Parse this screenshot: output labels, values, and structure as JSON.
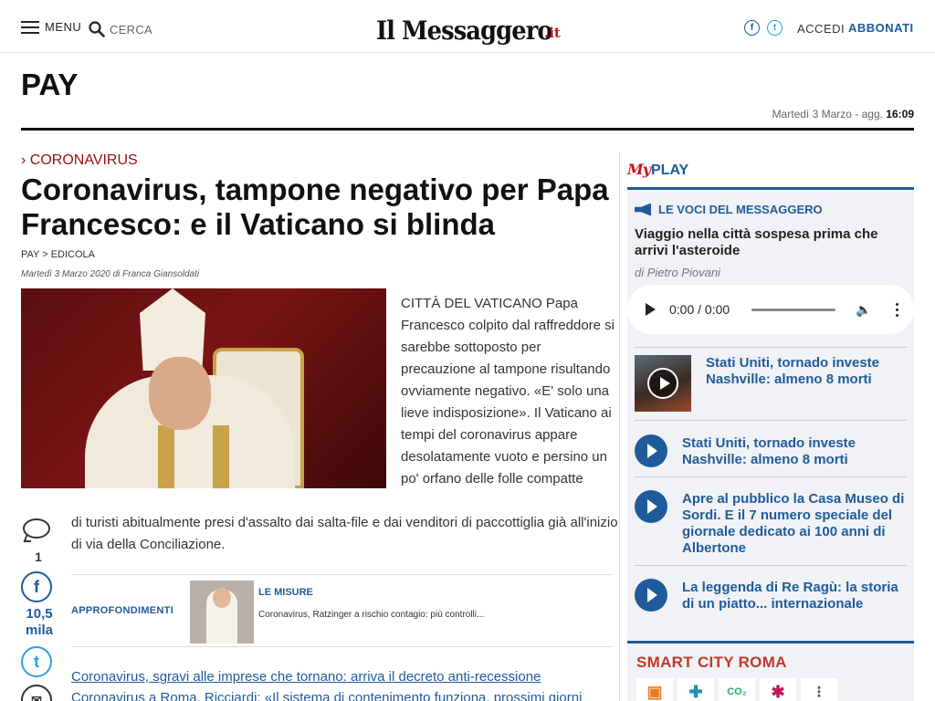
{
  "header": {
    "menu_label": "MENU",
    "search_label": "CERCA",
    "logo_text": "Il Messaggero",
    "logo_suffix": ".it",
    "login_label": "ACCEDI",
    "subscribe_label": "ABBONATI"
  },
  "section": {
    "title": "PAY",
    "date_text": "Martedì 3 Marzo - agg.",
    "update_time": "16:09"
  },
  "article": {
    "kicker": "› CORONAVIRUS",
    "headline": "Coronavirus, tampone negativo per Papa Francesco: e il Vaticano si blinda",
    "breadcrumbs": "PAY > EDICOLA",
    "byline": "Martedì 3 Marzo 2020 di Franca Giansoldati",
    "body_part1": "CITTÀ DEL VATICANO Papa Francesco colpito dal raffreddore si sarebbe sottoposto per precauzione al tampone risultando ovviamente negativo. «E' solo una lieve indisposizione». Il Vaticano ai tempi del coronavirus appare desolatamente vuoto e persino un po' orfano delle folle compatte",
    "body_part2": "di turisti abitualmente presi d'assalto dai salta-file e dai venditori di paccottiglia già all'inizio di via della Conciliazione.",
    "comment_count": "1",
    "share_count": "10,5 mila",
    "approfondimenti_label": "APPROFONDIMENTI",
    "approf_kicker": "LE MISURE",
    "approf_title": "Coronavirus, Ratzinger a rischio contagio: più controlli...",
    "related_1": "Coronavirus, sgravi alle imprese che tornano: arriva il decreto anti-recessione",
    "related_2": "Coronavirus a Roma, Ricciardi: «Il sistema di contenimento funziona, prossimi giorni"
  },
  "sidebar": {
    "myplay_logo": "My",
    "myplay_label": "PLAY",
    "voci_label": "LE VOCI DEL MESSAGGERO",
    "voci_title": "Viaggio nella città sospesa prima che arrivi l'asteroide",
    "voci_author": "di Pietro Piovani",
    "audio_time": "0:00 / 0:00",
    "videos": [
      {
        "title": "Stati Uniti, tornado investe Nashville: almeno 8 morti"
      },
      {
        "title": "Stati Uniti, tornado investe Nashville: almeno 8 morti"
      },
      {
        "title": "Apre al pubblico la Casa Museo di Sordi. E il 7 numero speciale del giornale dedicato ai 100 anni di Albertone"
      },
      {
        "title": "La leggenda di Re Ragù: la storia di un piatto... internazionale"
      }
    ],
    "smart_city_title": "SMART CITY ROMA"
  },
  "colors": {
    "brand_blue": "#1f5b9a",
    "kicker_red": "#9b0e15",
    "smart_red": "#c0392b"
  }
}
